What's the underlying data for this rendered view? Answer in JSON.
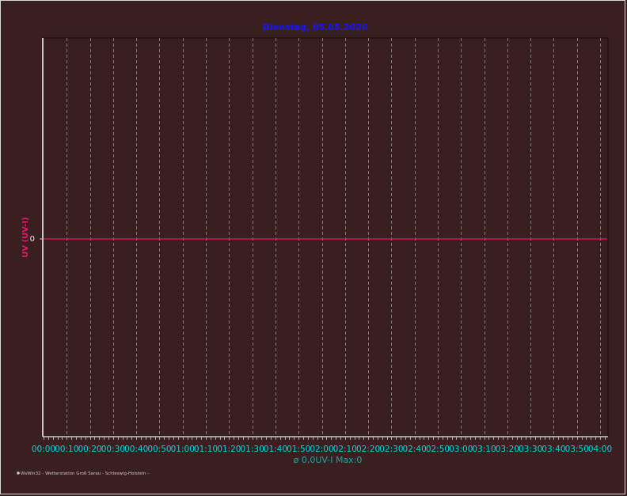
{
  "chart_data": {
    "type": "line",
    "title": "Dienstag, 05.05.2026",
    "ylabel": "UV (UV-I)",
    "y_ticks": [
      "0"
    ],
    "ylim": [
      -1,
      1
    ],
    "x_ticks": [
      "00:00",
      "00:10",
      "00:20",
      "00:30",
      "00:40",
      "00:50",
      "01:00",
      "01:10",
      "01:20",
      "01:30",
      "01:40",
      "01:50",
      "02:00",
      "02:10",
      "02:20",
      "02:30",
      "02:40",
      "02:50",
      "03:00",
      "03:10",
      "03:20",
      "03:30",
      "03:40",
      "03:50",
      "04:00"
    ],
    "x_minutes": [
      0,
      10,
      20,
      30,
      40,
      50,
      60,
      70,
      80,
      90,
      100,
      110,
      120,
      130,
      140,
      150,
      160,
      170,
      180,
      190,
      200,
      210,
      220,
      230,
      240
    ],
    "xlim_minutes": [
      0,
      243
    ],
    "series": [
      {
        "x_minutes": [
          0,
          243
        ],
        "values": [
          0,
          0
        ]
      }
    ],
    "grid": "vertical-dashed",
    "summary": "ø 0,0UV-I  Max:0",
    "colors": {
      "background": "#3a1f21",
      "title": "#1414ff",
      "tick_labels": "#00d8e0",
      "ylabel": "#e0186a",
      "series": "#e0186a",
      "summary": "#1aa6a8",
      "grid": "#c8c8c8",
      "axis": "#c8c8c8"
    }
  },
  "footer": {
    "text": "WsWin32 - Wetterstation Groß Sarau - Schleswig-Holstein -"
  }
}
